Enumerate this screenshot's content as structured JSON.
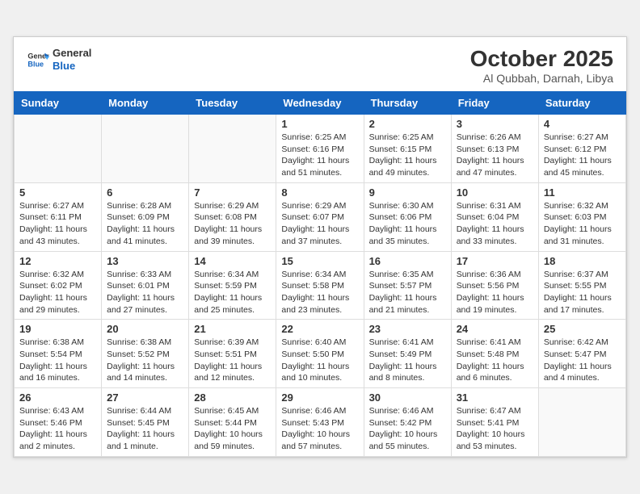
{
  "header": {
    "logo_line1": "General",
    "logo_line2": "Blue",
    "month_year": "October 2025",
    "location": "Al Qubbah, Darnah, Libya"
  },
  "weekdays": [
    "Sunday",
    "Monday",
    "Tuesday",
    "Wednesday",
    "Thursday",
    "Friday",
    "Saturday"
  ],
  "weeks": [
    [
      {
        "day": "",
        "info": ""
      },
      {
        "day": "",
        "info": ""
      },
      {
        "day": "",
        "info": ""
      },
      {
        "day": "1",
        "info": "Sunrise: 6:25 AM\nSunset: 6:16 PM\nDaylight: 11 hours\nand 51 minutes."
      },
      {
        "day": "2",
        "info": "Sunrise: 6:25 AM\nSunset: 6:15 PM\nDaylight: 11 hours\nand 49 minutes."
      },
      {
        "day": "3",
        "info": "Sunrise: 6:26 AM\nSunset: 6:13 PM\nDaylight: 11 hours\nand 47 minutes."
      },
      {
        "day": "4",
        "info": "Sunrise: 6:27 AM\nSunset: 6:12 PM\nDaylight: 11 hours\nand 45 minutes."
      }
    ],
    [
      {
        "day": "5",
        "info": "Sunrise: 6:27 AM\nSunset: 6:11 PM\nDaylight: 11 hours\nand 43 minutes."
      },
      {
        "day": "6",
        "info": "Sunrise: 6:28 AM\nSunset: 6:09 PM\nDaylight: 11 hours\nand 41 minutes."
      },
      {
        "day": "7",
        "info": "Sunrise: 6:29 AM\nSunset: 6:08 PM\nDaylight: 11 hours\nand 39 minutes."
      },
      {
        "day": "8",
        "info": "Sunrise: 6:29 AM\nSunset: 6:07 PM\nDaylight: 11 hours\nand 37 minutes."
      },
      {
        "day": "9",
        "info": "Sunrise: 6:30 AM\nSunset: 6:06 PM\nDaylight: 11 hours\nand 35 minutes."
      },
      {
        "day": "10",
        "info": "Sunrise: 6:31 AM\nSunset: 6:04 PM\nDaylight: 11 hours\nand 33 minutes."
      },
      {
        "day": "11",
        "info": "Sunrise: 6:32 AM\nSunset: 6:03 PM\nDaylight: 11 hours\nand 31 minutes."
      }
    ],
    [
      {
        "day": "12",
        "info": "Sunrise: 6:32 AM\nSunset: 6:02 PM\nDaylight: 11 hours\nand 29 minutes."
      },
      {
        "day": "13",
        "info": "Sunrise: 6:33 AM\nSunset: 6:01 PM\nDaylight: 11 hours\nand 27 minutes."
      },
      {
        "day": "14",
        "info": "Sunrise: 6:34 AM\nSunset: 5:59 PM\nDaylight: 11 hours\nand 25 minutes."
      },
      {
        "day": "15",
        "info": "Sunrise: 6:34 AM\nSunset: 5:58 PM\nDaylight: 11 hours\nand 23 minutes."
      },
      {
        "day": "16",
        "info": "Sunrise: 6:35 AM\nSunset: 5:57 PM\nDaylight: 11 hours\nand 21 minutes."
      },
      {
        "day": "17",
        "info": "Sunrise: 6:36 AM\nSunset: 5:56 PM\nDaylight: 11 hours\nand 19 minutes."
      },
      {
        "day": "18",
        "info": "Sunrise: 6:37 AM\nSunset: 5:55 PM\nDaylight: 11 hours\nand 17 minutes."
      }
    ],
    [
      {
        "day": "19",
        "info": "Sunrise: 6:38 AM\nSunset: 5:54 PM\nDaylight: 11 hours\nand 16 minutes."
      },
      {
        "day": "20",
        "info": "Sunrise: 6:38 AM\nSunset: 5:52 PM\nDaylight: 11 hours\nand 14 minutes."
      },
      {
        "day": "21",
        "info": "Sunrise: 6:39 AM\nSunset: 5:51 PM\nDaylight: 11 hours\nand 12 minutes."
      },
      {
        "day": "22",
        "info": "Sunrise: 6:40 AM\nSunset: 5:50 PM\nDaylight: 11 hours\nand 10 minutes."
      },
      {
        "day": "23",
        "info": "Sunrise: 6:41 AM\nSunset: 5:49 PM\nDaylight: 11 hours\nand 8 minutes."
      },
      {
        "day": "24",
        "info": "Sunrise: 6:41 AM\nSunset: 5:48 PM\nDaylight: 11 hours\nand 6 minutes."
      },
      {
        "day": "25",
        "info": "Sunrise: 6:42 AM\nSunset: 5:47 PM\nDaylight: 11 hours\nand 4 minutes."
      }
    ],
    [
      {
        "day": "26",
        "info": "Sunrise: 6:43 AM\nSunset: 5:46 PM\nDaylight: 11 hours\nand 2 minutes."
      },
      {
        "day": "27",
        "info": "Sunrise: 6:44 AM\nSunset: 5:45 PM\nDaylight: 11 hours\nand 1 minute."
      },
      {
        "day": "28",
        "info": "Sunrise: 6:45 AM\nSunset: 5:44 PM\nDaylight: 10 hours\nand 59 minutes."
      },
      {
        "day": "29",
        "info": "Sunrise: 6:46 AM\nSunset: 5:43 PM\nDaylight: 10 hours\nand 57 minutes."
      },
      {
        "day": "30",
        "info": "Sunrise: 6:46 AM\nSunset: 5:42 PM\nDaylight: 10 hours\nand 55 minutes."
      },
      {
        "day": "31",
        "info": "Sunrise: 6:47 AM\nSunset: 5:41 PM\nDaylight: 10 hours\nand 53 minutes."
      },
      {
        "day": "",
        "info": ""
      }
    ]
  ]
}
